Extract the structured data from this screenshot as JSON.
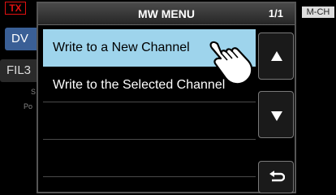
{
  "background": {
    "tx_label": "TX",
    "mode_button_label": "DV",
    "filter_button_label": "FIL3",
    "s_label": "S",
    "po_label": "Po",
    "mode_tag_label": "M-CH"
  },
  "menu": {
    "title": "MW MENU",
    "page_indicator": "1/1",
    "items": [
      {
        "label": "Write to a New Channel",
        "selected": true
      },
      {
        "label": "Write to the Selected Channel",
        "selected": false
      }
    ],
    "icons": {
      "scroll_up": "triangle-up-icon",
      "scroll_down": "triangle-down-icon",
      "back": "return-arrow-icon",
      "pointer": "pointing-hand-icon"
    }
  },
  "colors": {
    "selected_row": "#9ed4ec",
    "tx_red": "#e01010",
    "header_gray": "#3a3a3a"
  }
}
